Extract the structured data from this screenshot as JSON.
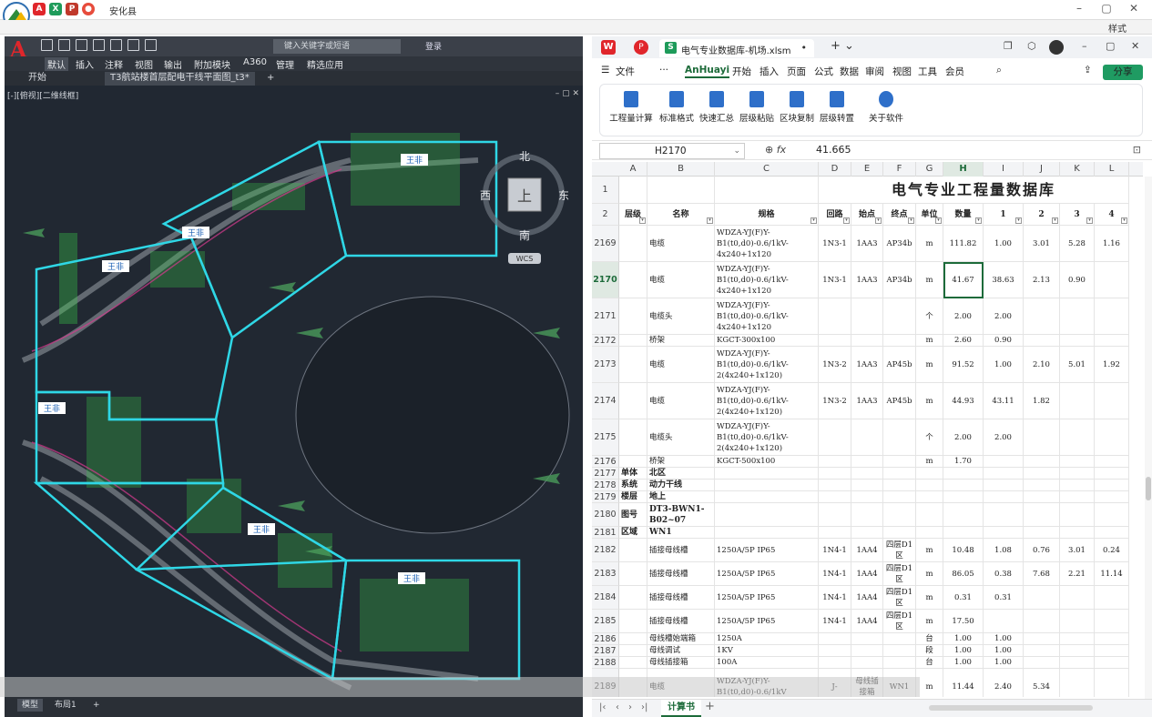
{
  "outer": {
    "app_title": "安化县",
    "style_label": "样式",
    "min": "–",
    "max": "▢",
    "close": "✕"
  },
  "cad": {
    "search_placeholder": "键入关键字或短语",
    "login": "登录",
    "ribbon_tabs": [
      "默认",
      "插入",
      "注释",
      "视图",
      "输出",
      "附加模块",
      "A360",
      "管理",
      "精选应用"
    ],
    "doc_tabs": [
      "开始",
      "T3航站楼首层配电干线平面图_t3*"
    ],
    "viewport_label": "[-][俯视][二维线框]",
    "viewcube_top": "上",
    "viewcube_n": "北",
    "viewcube_s": "南",
    "viewcube_e": "东",
    "viewcube_w": "西",
    "wcs": "WCS",
    "zone_labels": [
      "王非",
      "王非",
      "王非",
      "王非",
      "王非",
      "王非",
      "王非"
    ],
    "layout_tabs": [
      "模型",
      "布局1"
    ]
  },
  "ws": {
    "tab_title": "电气专业数据库-机场.xlsm",
    "menu": [
      "文件",
      "AnHuayi",
      "开始",
      "插入",
      "页面",
      "公式",
      "数据",
      "审阅",
      "视图",
      "工具",
      "会员"
    ],
    "share": "分享",
    "ribbon_buttons": [
      "工程量计算",
      "标准格式",
      "快速汇总",
      "层级粘贴",
      "区块复制",
      "层级转置",
      "关于软件"
    ],
    "name_box": "H2170",
    "formula_value": "41.665",
    "sheet_tab": "计算书",
    "columns": [
      "A",
      "B",
      "C",
      "D",
      "E",
      "F",
      "G",
      "H",
      "I",
      "J",
      "K",
      "L"
    ],
    "title_row": "电气专业工程量数据库",
    "headers": [
      "层级",
      "名称",
      "规格",
      "回路",
      "始点",
      "终点",
      "单位",
      "数量",
      "1",
      "2",
      "3",
      "4"
    ],
    "rows": [
      {
        "n": "2169",
        "a": "",
        "b": "电缆",
        "c": "WDZA-YJ(F)Y-B1(t0,d0)-0.6/1kV-4x240+1x120",
        "d": "1N3-1",
        "e": "1AA3",
        "f": "AP34b",
        "g": "m",
        "h": "111.82",
        "i": "1.00",
        "j": "3.01",
        "k": "5.28",
        "l": "1.16"
      },
      {
        "n": "2170",
        "a": "",
        "b": "电缆",
        "c": "WDZA-YJ(F)Y-B1(t0,d0)-0.6/1kV-4x240+1x120",
        "d": "1N3-1",
        "e": "1AA3",
        "f": "AP34b",
        "g": "m",
        "h": "41.67",
        "i": "38.63",
        "j": "2.13",
        "k": "0.90",
        "l": ""
      },
      {
        "n": "2171",
        "a": "",
        "b": "电缆头",
        "c": "WDZA-YJ(F)Y-B1(t0,d0)-0.6/1kV-4x240+1x120",
        "d": "",
        "e": "",
        "f": "",
        "g": "个",
        "h": "2.00",
        "i": "2.00",
        "j": "",
        "k": "",
        "l": ""
      },
      {
        "n": "2172",
        "a": "",
        "b": "桥架",
        "c": "KGCT-300x100",
        "d": "",
        "e": "",
        "f": "",
        "g": "m",
        "h": "2.60",
        "i": "0.90",
        "j": "",
        "k": "",
        "l": ""
      },
      {
        "n": "2173",
        "a": "",
        "b": "电缆",
        "c": "WDZA-YJ(F)Y-B1(t0,d0)-0.6/1kV-2(4x240+1x120)",
        "d": "1N3-2",
        "e": "1AA3",
        "f": "AP45b",
        "g": "m",
        "h": "91.52",
        "i": "1.00",
        "j": "2.10",
        "k": "5.01",
        "l": "1.92"
      },
      {
        "n": "2174",
        "a": "",
        "b": "电缆",
        "c": "WDZA-YJ(F)Y-B1(t0,d0)-0.6/1kV-2(4x240+1x120)",
        "d": "1N3-2",
        "e": "1AA3",
        "f": "AP45b",
        "g": "m",
        "h": "44.93",
        "i": "43.11",
        "j": "1.82",
        "k": "",
        "l": ""
      },
      {
        "n": "2175",
        "a": "",
        "b": "电缆头",
        "c": "WDZA-YJ(F)Y-B1(t0,d0)-0.6/1kV-2(4x240+1x120)",
        "d": "",
        "e": "",
        "f": "",
        "g": "个",
        "h": "2.00",
        "i": "2.00",
        "j": "",
        "k": "",
        "l": ""
      },
      {
        "n": "2176",
        "a": "",
        "b": "桥架",
        "c": "KGCT-500x100",
        "d": "",
        "e": "",
        "f": "",
        "g": "m",
        "h": "1.70",
        "i": "",
        "j": "",
        "k": "",
        "l": ""
      },
      {
        "n": "2177",
        "a": "单体",
        "b": "北区",
        "c": "",
        "d": "",
        "e": "",
        "f": "",
        "g": "",
        "h": "",
        "i": "",
        "j": "",
        "k": "",
        "l": ""
      },
      {
        "n": "2178",
        "a": "系统",
        "b": "动力干线",
        "c": "",
        "d": "",
        "e": "",
        "f": "",
        "g": "",
        "h": "",
        "i": "",
        "j": "",
        "k": "",
        "l": ""
      },
      {
        "n": "2179",
        "a": "楼层",
        "b": "地上",
        "c": "",
        "d": "",
        "e": "",
        "f": "",
        "g": "",
        "h": "",
        "i": "",
        "j": "",
        "k": "",
        "l": ""
      },
      {
        "n": "2180",
        "a": "图号",
        "b": "DT3-BWN1-B02~07",
        "c": "",
        "d": "",
        "e": "",
        "f": "",
        "g": "",
        "h": "",
        "i": "",
        "j": "",
        "k": "",
        "l": ""
      },
      {
        "n": "2181",
        "a": "区域",
        "b": "WN1",
        "c": "",
        "d": "",
        "e": "",
        "f": "",
        "g": "",
        "h": "",
        "i": "",
        "j": "",
        "k": "",
        "l": ""
      },
      {
        "n": "2182",
        "a": "",
        "b": "插接母线槽",
        "c": "1250A/5P IP65",
        "d": "1N4-1",
        "e": "1AA4",
        "f": "四层D1区",
        "g": "m",
        "h": "10.48",
        "i": "1.08",
        "j": "0.76",
        "k": "3.01",
        "l": "0.24"
      },
      {
        "n": "2183",
        "a": "",
        "b": "插接母线槽",
        "c": "1250A/5P IP65",
        "d": "1N4-1",
        "e": "1AA4",
        "f": "四层D1区",
        "g": "m",
        "h": "86.05",
        "i": "0.38",
        "j": "7.68",
        "k": "2.21",
        "l": "11.14"
      },
      {
        "n": "2184",
        "a": "",
        "b": "插接母线槽",
        "c": "1250A/5P IP65",
        "d": "1N4-1",
        "e": "1AA4",
        "f": "四层D1区",
        "g": "m",
        "h": "0.31",
        "i": "0.31",
        "j": "",
        "k": "",
        "l": ""
      },
      {
        "n": "2185",
        "a": "",
        "b": "插接母线槽",
        "c": "1250A/5P IP65",
        "d": "1N4-1",
        "e": "1AA4",
        "f": "四层D1区",
        "g": "m",
        "h": "17.50",
        "i": "",
        "j": "",
        "k": "",
        "l": ""
      },
      {
        "n": "2186",
        "a": "",
        "b": "母线槽始端箱",
        "c": "1250A",
        "d": "",
        "e": "",
        "f": "",
        "g": "台",
        "h": "1.00",
        "i": "1.00",
        "j": "",
        "k": "",
        "l": ""
      },
      {
        "n": "2187",
        "a": "",
        "b": "母线调试",
        "c": "1KV",
        "d": "",
        "e": "",
        "f": "",
        "g": "段",
        "h": "1.00",
        "i": "1.00",
        "j": "",
        "k": "",
        "l": ""
      },
      {
        "n": "2188",
        "a": "",
        "b": "母线插接箱",
        "c": "100A",
        "d": "",
        "e": "",
        "f": "",
        "g": "台",
        "h": "1.00",
        "i": "1.00",
        "j": "",
        "k": "",
        "l": ""
      },
      {
        "n": "2189",
        "a": "",
        "b": "电缆",
        "c": "WDZA-YJ(F)Y-B1(t0,d0)-0.6/1kV",
        "d": "J-",
        "e": "母线插接箱",
        "f": "WN1",
        "g": "m",
        "h": "11.44",
        "i": "2.40",
        "j": "5.34",
        "k": "",
        "l": ""
      }
    ]
  }
}
